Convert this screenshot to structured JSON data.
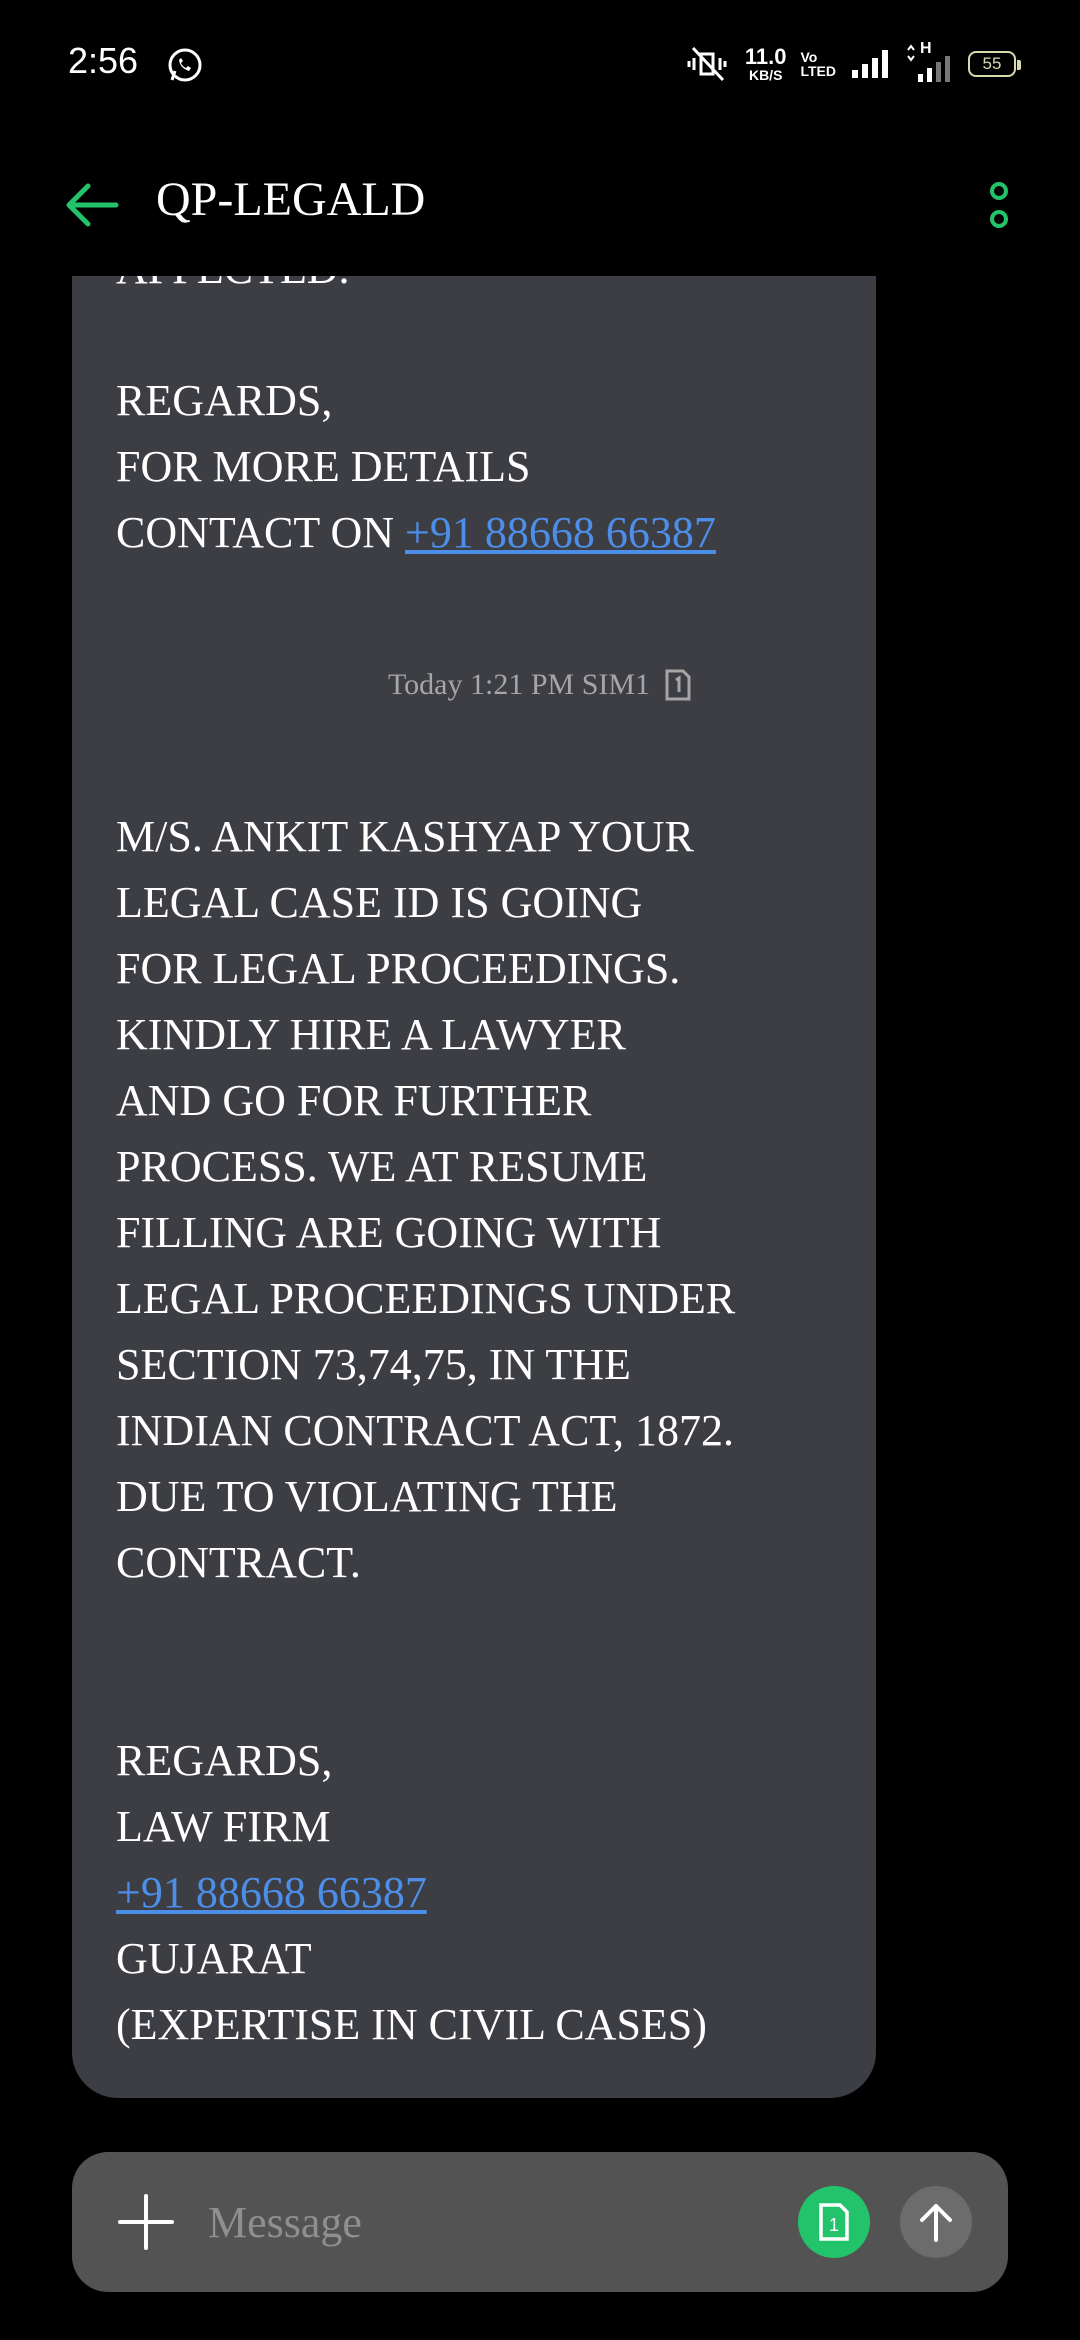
{
  "status_bar": {
    "time": "2:56",
    "net_speed_value": "11.0",
    "net_speed_unit": "KB/S",
    "volte_top": "Vo",
    "volte_bottom": "LTED",
    "network_type": "H",
    "battery": "55"
  },
  "header": {
    "title": "QP-LEGALD",
    "accent_color": "#22c36b"
  },
  "messages": [
    {
      "text_before_link": "AFFECTED.\n\nREGARDS,\nFOR MORE DETAILS\nCONTACT ON ",
      "link": "+91 88668 66387"
    },
    {
      "text": "M/S. ANKIT KASHYAP YOUR\nLEGAL CASE ID  IS GOING\nFOR LEGAL PROCEEDINGS.\nKINDLY HIRE A LAWYER\nAND GO FOR FURTHER\nPROCESS. WE AT RESUME\nFILLING  ARE GOING WITH\nLEGAL PROCEEDINGS UNDER\nSECTION 73,74,75, IN THE\nINDIAN CONTRACT ACT, 1872.\nDUE TO VIOLATING THE\nCONTRACT.\n\n\nREGARDS,\nLAW FIRM\n",
      "link": "+91  88668 66387",
      "text_after_link": "\nGUJARAT\n(EXPERTISE IN CIVIL CASES)"
    }
  ],
  "timestamp": {
    "text": "Today 1:21 PM  SIM1"
  },
  "composer": {
    "placeholder": "Message",
    "sim_label": "1"
  }
}
